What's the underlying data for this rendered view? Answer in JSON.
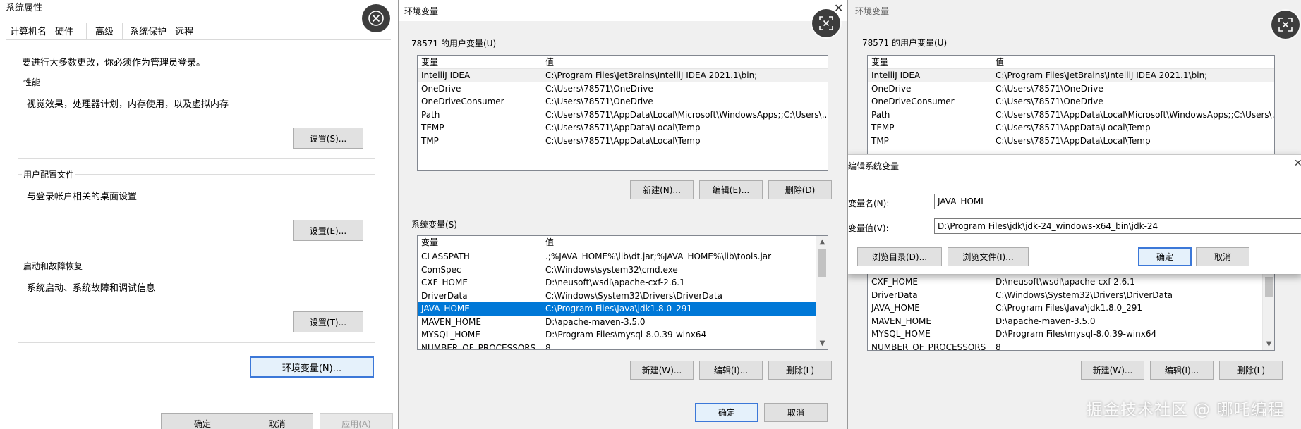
{
  "system_props": {
    "title": "系统属性",
    "tabs": [
      "计算机名",
      "硬件",
      "高级",
      "系统保护",
      "远程"
    ],
    "admin_note": "要进行大多数更改，你必须作为管理员登录。",
    "performance": {
      "legend": "性能",
      "text": "视觉效果，处理器计划，内存使用，以及虚拟内存",
      "button": "设置(S)..."
    },
    "profiles": {
      "legend": "用户配置文件",
      "text": "与登录帐户相关的桌面设置",
      "button": "设置(E)..."
    },
    "startup": {
      "legend": "启动和故障恢复",
      "text": "系统启动、系统故障和调试信息",
      "button": "设置(T)..."
    },
    "env_button": "环境变量(N)...",
    "ok": "确定",
    "cancel": "取消",
    "apply": "应用(A)"
  },
  "env_vars": {
    "title": "环境变量",
    "user_section": "78571 的用户变量(U)",
    "col_var": "变量",
    "col_val": "值",
    "user_rows": [
      {
        "name": "IntelliJ IDEA",
        "value": "C:\\Program Files\\JetBrains\\IntelliJ IDEA 2021.1\\bin;"
      },
      {
        "name": "OneDrive",
        "value": "C:\\Users\\78571\\OneDrive"
      },
      {
        "name": "OneDriveConsumer",
        "value": "C:\\Users\\78571\\OneDrive"
      },
      {
        "name": "Path",
        "value": "C:\\Users\\78571\\AppData\\Local\\Microsoft\\WindowsApps;;C:\\Users\\..."
      },
      {
        "name": "TEMP",
        "value": "C:\\Users\\78571\\AppData\\Local\\Temp"
      },
      {
        "name": "TMP",
        "value": "C:\\Users\\78571\\AppData\\Local\\Temp"
      }
    ],
    "user_buttons": {
      "new": "新建(N)...",
      "edit": "编辑(E)...",
      "delete": "删除(D)"
    },
    "system_section": "系统变量(S)",
    "system_rows": [
      {
        "name": "CLASSPATH",
        "value": ".;%JAVA_HOME%\\lib\\dt.jar;%JAVA_HOME%\\lib\\tools.jar"
      },
      {
        "name": "ComSpec",
        "value": "C:\\Windows\\system32\\cmd.exe"
      },
      {
        "name": "CXF_HOME",
        "value": "D:\\neusoft\\wsdl\\apache-cxf-2.6.1"
      },
      {
        "name": "DriverData",
        "value": "C:\\Windows\\System32\\Drivers\\DriverData"
      },
      {
        "name": "JAVA_HOME",
        "value": "C:\\Program Files\\Java\\jdk1.8.0_291"
      },
      {
        "name": "MAVEN_HOME",
        "value": "D:\\apache-maven-3.5.0"
      },
      {
        "name": "MYSQL_HOME",
        "value": "D:\\Program Files\\mysql-8.0.39-winx64"
      },
      {
        "name": "NUMBER_OF_PROCESSORS",
        "value": "8"
      }
    ],
    "system_buttons": {
      "new": "新建(W)...",
      "edit": "编辑(I)...",
      "delete": "删除(L)"
    },
    "ok": "确定",
    "cancel": "取消"
  },
  "env_vars_right": {
    "title": "环境变量",
    "user_section": "78571 的用户变量(U)",
    "col_var": "变量",
    "col_val": "值",
    "user_rows": [
      {
        "name": "IntelliJ IDEA",
        "value": "C:\\Program Files\\JetBrains\\IntelliJ IDEA 2021.1\\bin;"
      },
      {
        "name": "OneDrive",
        "value": "C:\\Users\\78571\\OneDrive"
      },
      {
        "name": "OneDriveConsumer",
        "value": "C:\\Users\\78571\\OneDrive"
      },
      {
        "name": "Path",
        "value": "C:\\Users\\78571\\AppData\\Local\\Microsoft\\WindowsApps;;C:\\Users\\..."
      },
      {
        "name": "TEMP",
        "value": "C:\\Users\\78571\\AppData\\Local\\Temp"
      },
      {
        "name": "TMP",
        "value": "C:\\Users\\78571\\AppData\\Local\\Temp"
      }
    ],
    "system_rows": [
      {
        "name": "CXF_HOME",
        "value": "D:\\neusoft\\wsdl\\apache-cxf-2.6.1"
      },
      {
        "name": "DriverData",
        "value": "C:\\Windows\\System32\\Drivers\\DriverData"
      },
      {
        "name": "JAVA_HOME",
        "value": "C:\\Program Files\\Java\\jdk1.8.0_291"
      },
      {
        "name": "MAVEN_HOME",
        "value": "D:\\apache-maven-3.5.0"
      },
      {
        "name": "MYSQL_HOME",
        "value": "D:\\Program Files\\mysql-8.0.39-winx64"
      },
      {
        "name": "NUMBER_OF_PROCESSORS",
        "value": "8"
      }
    ],
    "system_buttons": {
      "new": "新建(W)...",
      "edit": "编辑(I)...",
      "delete": "删除(L)"
    }
  },
  "edit_dialog": {
    "title": "编辑系统变量",
    "name_label": "变量名(N):",
    "value_label": "变量值(V):",
    "name_value": "JAVA_HOML",
    "value_value": "D:\\Program Files\\jdk\\jdk-24_windows-x64_bin\\jdk-24",
    "browse_dir": "浏览目录(D)...",
    "browse_file": "浏览文件(I)...",
    "ok": "确定",
    "cancel": "取消"
  },
  "watermark": "掘金技术社区 @ 哪吒编程",
  "icons": {
    "close": "close-icon",
    "zoom": "zoom-fit-icon"
  }
}
